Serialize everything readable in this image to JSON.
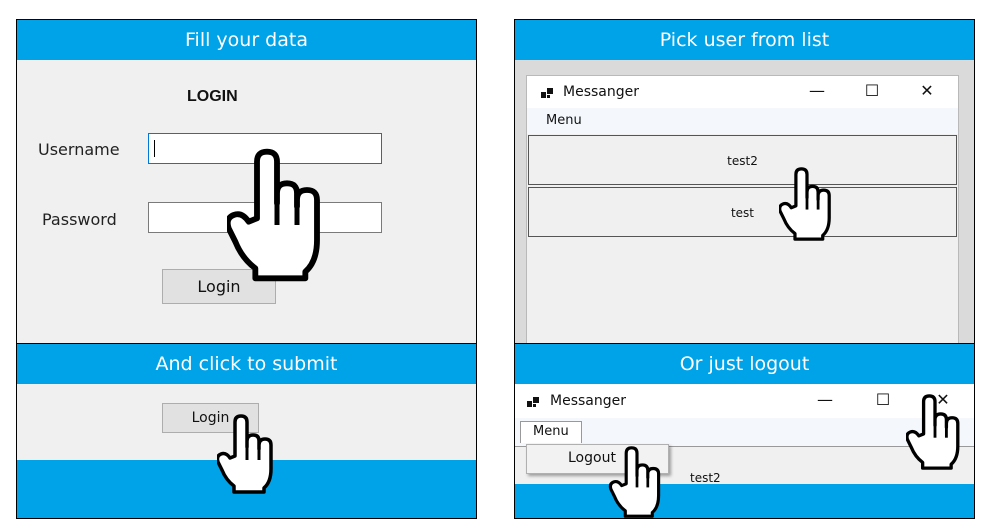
{
  "panel1": {
    "header": "Fill your data",
    "title": "LOGIN",
    "username_label": "Username",
    "password_label": "Password",
    "login_button": "Login"
  },
  "panel2": {
    "header": "Pick user from list",
    "window_title": "Messanger",
    "menu": "Menu",
    "users": [
      "test2",
      "test"
    ],
    "controls": {
      "minimize": "—",
      "maximize": "☐",
      "close": "✕"
    }
  },
  "panel3": {
    "header": "And click to submit",
    "login_button": "Login"
  },
  "panel4": {
    "header": "Or just logout",
    "window_title": "Messanger",
    "menu": "Menu",
    "menu_item": "Logout",
    "list_item": "test2",
    "controls": {
      "minimize": "—",
      "maximize": "☐",
      "close": "✕"
    }
  },
  "colors": {
    "band": "#00a2e8",
    "focus": "#0078d7",
    "window_bg": "#f0f0f0"
  },
  "icons": {
    "pointer": "hand-pointer-icon",
    "app": "app-icon"
  }
}
